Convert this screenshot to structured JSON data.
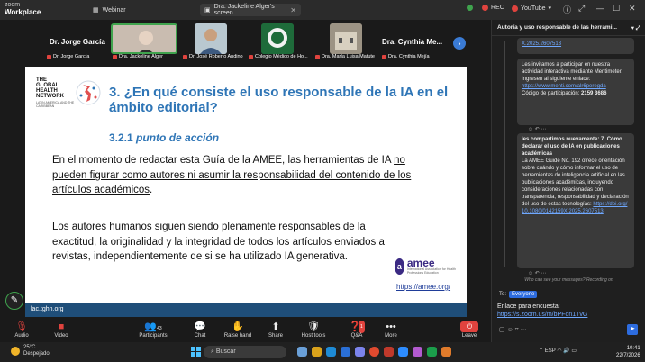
{
  "app": {
    "logo_line1": "zoom",
    "logo_line2": "Workplace"
  },
  "tabs": [
    {
      "label": "Webinar"
    },
    {
      "label": "Dra. Jackeline Alger's screen"
    }
  ],
  "titlebar": {
    "rec": "REC",
    "youtube": "YouTube"
  },
  "participants_strip": [
    {
      "name": "Dr. Jorge García",
      "label": "Dr. Jorge García"
    },
    {
      "name": "",
      "label": "Dra. Jackeline Alger"
    },
    {
      "name": "",
      "label": "Dr. José Roberto Andino"
    },
    {
      "name": "",
      "label": "Colegio Médico de Ho..."
    },
    {
      "name": "",
      "label": "Dra. María Luisa Matute"
    },
    {
      "name": "Dra. Cynthia Me...",
      "label": "Dra. Cynthia Mejía"
    }
  ],
  "slide": {
    "org_line1": "THE",
    "org_line2": "GLOBAL",
    "org_line3": "HEALTH",
    "org_line4": "NETWORK",
    "org_small": "LATIN AMERICA AND THE CARIBBEAN",
    "title": "3. ¿En qué consiste el uso responsable de la IA en el ámbito editorial?",
    "section_number": "3.2.1",
    "section_title": "punto de acción",
    "para1_a": "En el momento de redactar esta Guía de la AMEE, las herramientas de IA ",
    "para1_b": "no pueden figurar como autores ni asumir la responsabilidad del contenido de los artículos académicos",
    "para1_c": ".",
    "para2_a": "Los autores humanos siguen siendo ",
    "para2_b": "plenamente responsables",
    "para2_c": " de la exactitud, la originalidad y la integridad de todos los artículos enviados a revistas, independientemente de si se ha utilizado IA generativa.",
    "amee_logo": "amee",
    "amee_small": "International Association for Health Professions Education",
    "amee_link": "https://amee.org/",
    "footer": "lac.tghn.org"
  },
  "toolbar": [
    {
      "label": "Audio",
      "icon": "mic-muted-icon"
    },
    {
      "label": "Video",
      "icon": "video-off-icon"
    },
    {
      "label": "Participants",
      "icon": "participants-icon",
      "count": "43"
    },
    {
      "label": "Chat",
      "icon": "chat-icon"
    },
    {
      "label": "Raise hand",
      "icon": "raise-hand-icon"
    },
    {
      "label": "Share",
      "icon": "share-icon"
    },
    {
      "label": "Host tools",
      "icon": "host-tools-icon"
    },
    {
      "label": "Q&A",
      "icon": "qa-icon",
      "badge": "1"
    },
    {
      "label": "More",
      "icon": "more-icon"
    }
  ],
  "end_button": {
    "label": "Leave"
  },
  "chat": {
    "header": "Autoría y uso responsable de las herrami...",
    "b1": "X.2025.2607513",
    "b2_text": "Les invitamos a participar en nuestra actividad interactiva mediante Mentimeter. Ingresen al siguiente enlace:",
    "b2_link": "https://www.menti.com/alr6peregda",
    "b2_code_label": "Código de participación: ",
    "b2_code": "2159 3686",
    "b3_intro": "les compartimos nuevamente: 7. Cómo declarar el uso de IA en publicaciones académicas",
    "b3_body": "La AMEE Guide No. 192 ofrece orientación sobre cuándo y cómo informar el uso de herramientas de inteligencia artificial en las publicaciones académicas, incluyendo consideraciones relacionadas con transparencia, responsabilidad y declaración del uso de estas tecnologías:",
    "b3_link": "https://doi.org/10.1080/0142159X.2025.2607513",
    "seen": "Who can see your messages? Recording on",
    "to_label": "To:",
    "to_value": "Everyone",
    "input_line1": "Enlace para encuesta:",
    "input_line2": "https://s.zoom.us/m/bPFon1TvG"
  },
  "taskbar": {
    "temp": "25°C",
    "weather": "Despejado",
    "search_placeholder": "Buscar",
    "lang": "ESP",
    "time": "10:41",
    "date": "22/7/2026"
  }
}
